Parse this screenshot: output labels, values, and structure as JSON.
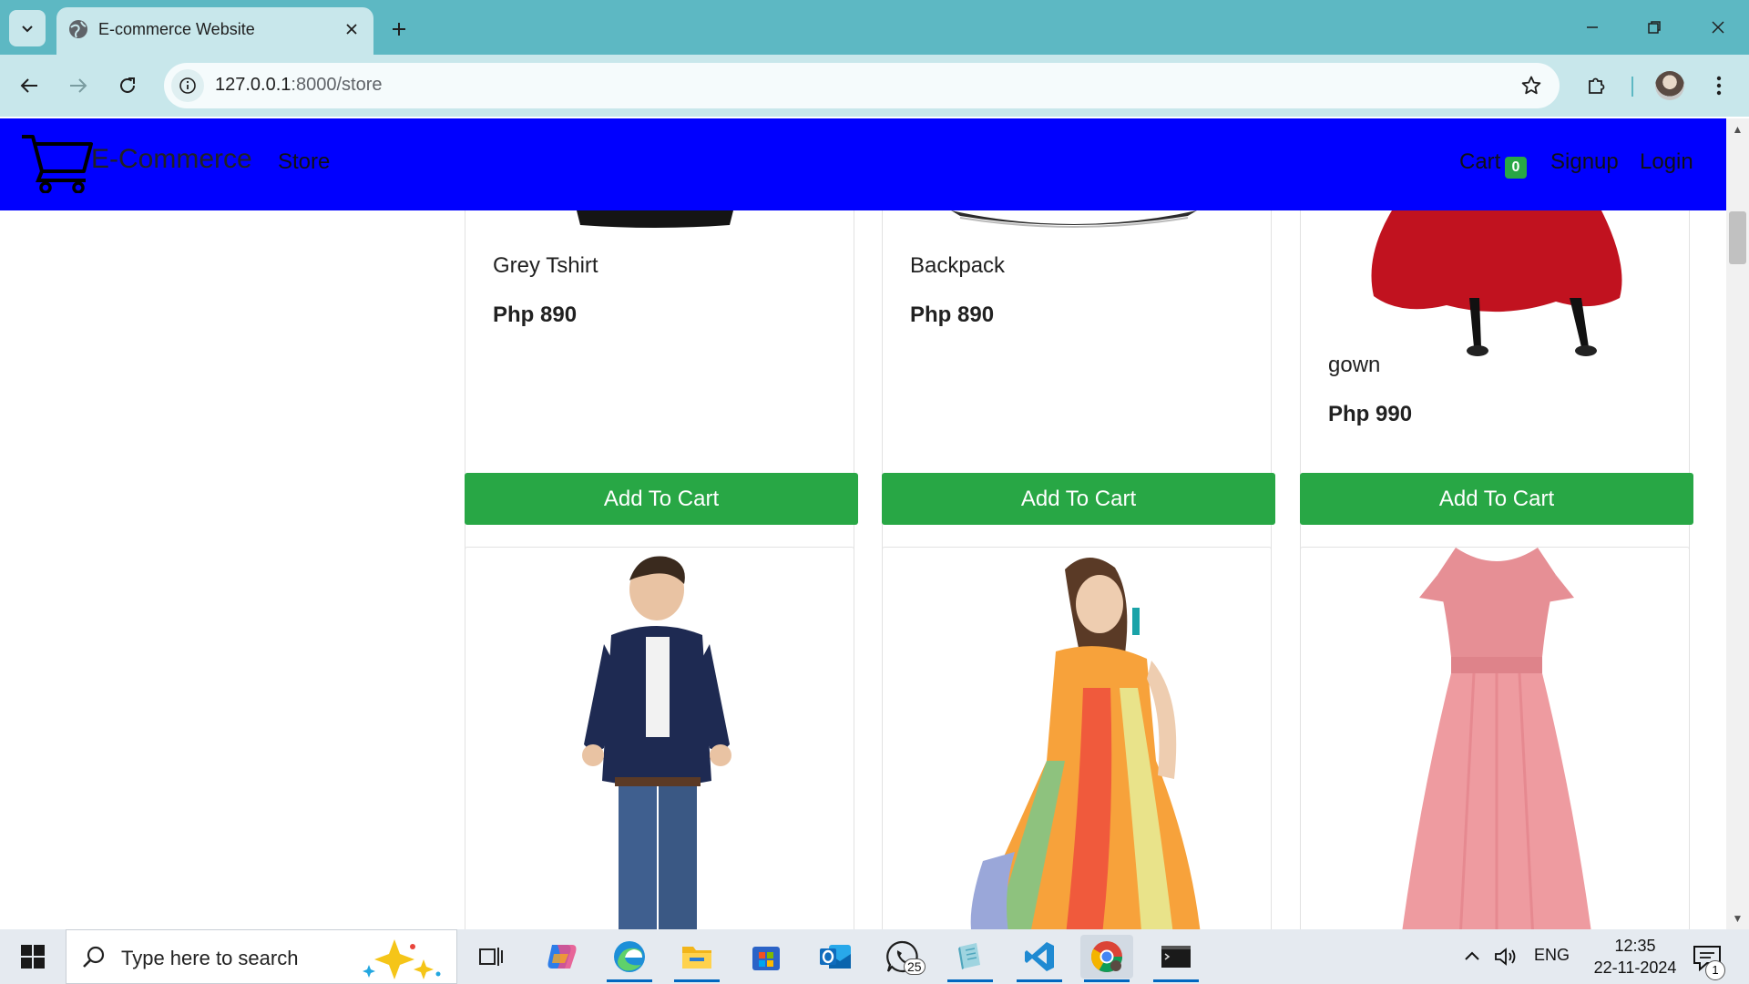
{
  "browser": {
    "tab_title": "E-commerce Website",
    "url_host": "127.0.0.1",
    "url_path": ":8000/store"
  },
  "site": {
    "brand": "E-Commerce",
    "nav_store": "Store",
    "nav_cart": "Cart",
    "cart_count": "0",
    "nav_signup": "Signup",
    "nav_login": "Login"
  },
  "products": [
    {
      "name": "Grey Tshirt",
      "price": "Php 890",
      "button": "Add To Cart"
    },
    {
      "name": "Backpack",
      "price": "Php 890",
      "button": "Add To Cart"
    },
    {
      "name": "gown",
      "price": "Php 990",
      "button": "Add To Cart"
    }
  ],
  "taskbar": {
    "search_placeholder": "Type here to search",
    "whatsapp_badge": "25",
    "lang": "ENG",
    "time": "12:35",
    "date": "22-11-2024",
    "notif_count": "1"
  },
  "colors": {
    "tab_bar": "#5db8c3",
    "toolbar": "#c8e7eb",
    "site_nav": "#0000ff",
    "button_green": "#28a745"
  }
}
